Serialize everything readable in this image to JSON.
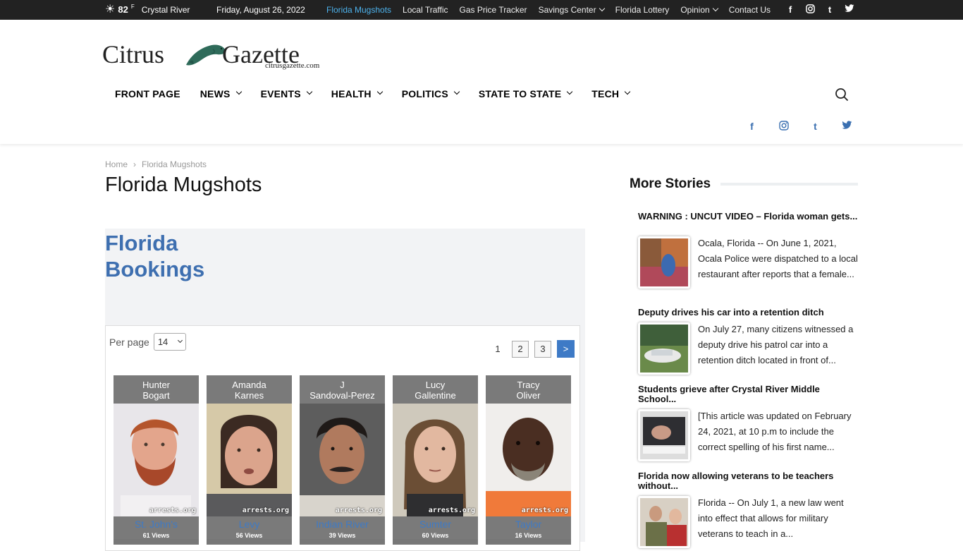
{
  "topbar": {
    "temperature": "82",
    "temp_unit": "F",
    "city": "Crystal River",
    "date": "Friday, August 26, 2022",
    "links": [
      "Florida Mugshots",
      "Local Traffic",
      "Gas Price Tracker",
      "Savings Center",
      "Florida Lottery",
      "Opinion",
      "Contact Us"
    ],
    "social": [
      "f",
      "◎",
      "t",
      "🐦"
    ]
  },
  "logo": {
    "word1": "Citrus",
    "word2": "Gazette",
    "url": "citrusgazette.com"
  },
  "nav": {
    "items": [
      "FRONT PAGE",
      "NEWS",
      "EVENTS",
      "HEALTH",
      "POLITICS",
      "STATE TO STATE",
      "TECH"
    ]
  },
  "breadcrumb": {
    "home": "Home",
    "sep": "›",
    "current": "Florida Mugshots"
  },
  "page": {
    "title": "Florida Mugshots"
  },
  "widget": {
    "title": "Florida Bookings",
    "per_page_label": "Per page",
    "per_page_value": "14",
    "pages": [
      "1",
      "2",
      "3"
    ],
    "next": ">",
    "cards": [
      {
        "first": "Hunter",
        "last": "Bogart",
        "county": "St. John's",
        "views": "61 Views",
        "watermark": "arrests.org"
      },
      {
        "first": "Amanda",
        "last": "Karnes",
        "county": "Levy",
        "views": "56 Views",
        "watermark": "arrests.org"
      },
      {
        "first": "J",
        "last": "Sandoval-Perez",
        "county": "Indian River",
        "views": "39 Views",
        "watermark": "arrests.org"
      },
      {
        "first": "Lucy",
        "last": "Gallentine",
        "county": "Sumter",
        "views": "60 Views",
        "watermark": "arrests.org"
      },
      {
        "first": "Tracy",
        "last": "Oliver",
        "county": "Taylor",
        "views": "16 Views",
        "watermark": "arrests.org"
      }
    ]
  },
  "sidebar": {
    "heading": "More Stories",
    "stories": [
      {
        "title": "WARNING : UNCUT VIDEO – Florida woman gets...",
        "excerpt": "Ocala, Florida -- On June 1, 2021, Ocala Police were dispatched to a local restaurant after reports that a female..."
      },
      {
        "title": "Deputy drives his car into a retention ditch",
        "excerpt": "On July 27, many citizens witnessed a deputy drive his patrol car into a retention ditch located in front of..."
      },
      {
        "title": "Students grieve after Crystal River Middle School...",
        "excerpt": "[This article was updated on February 24, 2021, at 10 p.m to include the correct spelling of his first name..."
      },
      {
        "title": "Florida now allowing veterans to be teachers without...",
        "excerpt": "Florida -- On July 1, a new law went into effect that allows for military veterans to teach in a..."
      }
    ]
  }
}
